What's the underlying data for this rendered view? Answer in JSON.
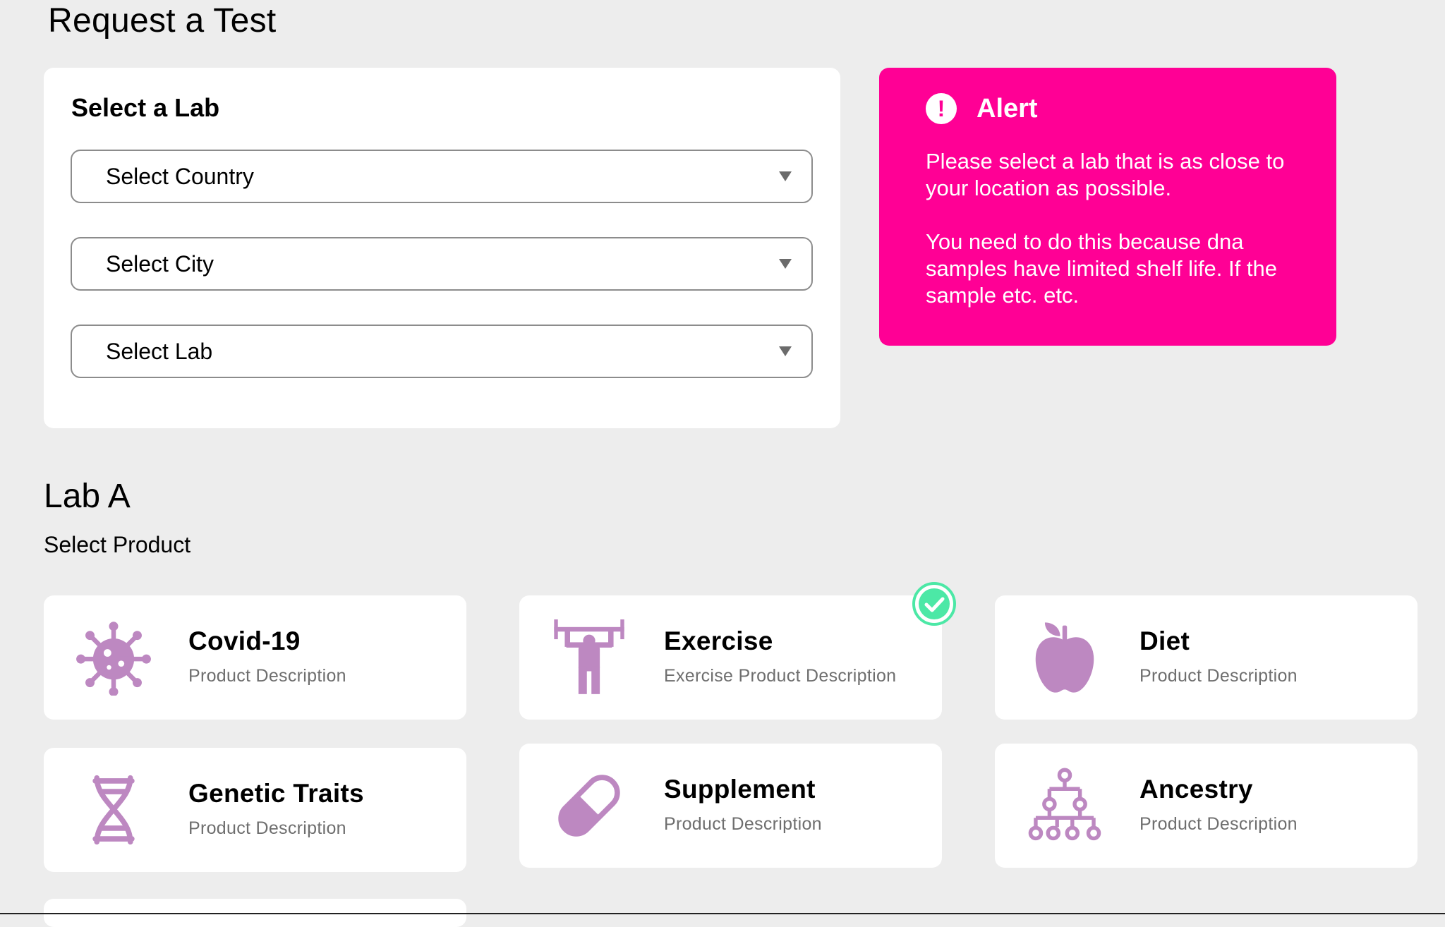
{
  "page_title": "Request a Test",
  "lab_form": {
    "title": "Select a Lab",
    "country_select": {
      "value": "Select Country"
    },
    "city_select": {
      "value": "Select City"
    },
    "lab_select": {
      "value": "Select Lab"
    }
  },
  "alert": {
    "icon": "exclamation-circle-icon",
    "title": "Alert",
    "paragraph_1": "Please select a lab that is as close to your location as possible.",
    "paragraph_2": "You need to do this because dna samples have limited shelf life. If the sample etc. etc.",
    "color": "#ff0095"
  },
  "lab_section": {
    "name": "Lab A",
    "subtitle": "Select Product"
  },
  "products": [
    {
      "name": "Covid-19",
      "description": "Product Description",
      "icon": "virus-icon",
      "selected": false
    },
    {
      "name": "Exercise",
      "description": "Exercise Product Description",
      "icon": "weightlifter-icon",
      "selected": true
    },
    {
      "name": "Diet",
      "description": "Product Description",
      "icon": "apple-icon",
      "selected": false
    },
    {
      "name": "Genetic Traits",
      "description": "Product Description",
      "icon": "dna-icon",
      "selected": false
    },
    {
      "name": "Supplement",
      "description": "Product Description",
      "icon": "pill-icon",
      "selected": false
    },
    {
      "name": "Ancestry",
      "description": "Product Description",
      "icon": "family-tree-icon",
      "selected": false
    }
  ],
  "colors": {
    "icon": "#bd88c1",
    "selected_check": "#4ce8a6",
    "background": "#ededed"
  }
}
